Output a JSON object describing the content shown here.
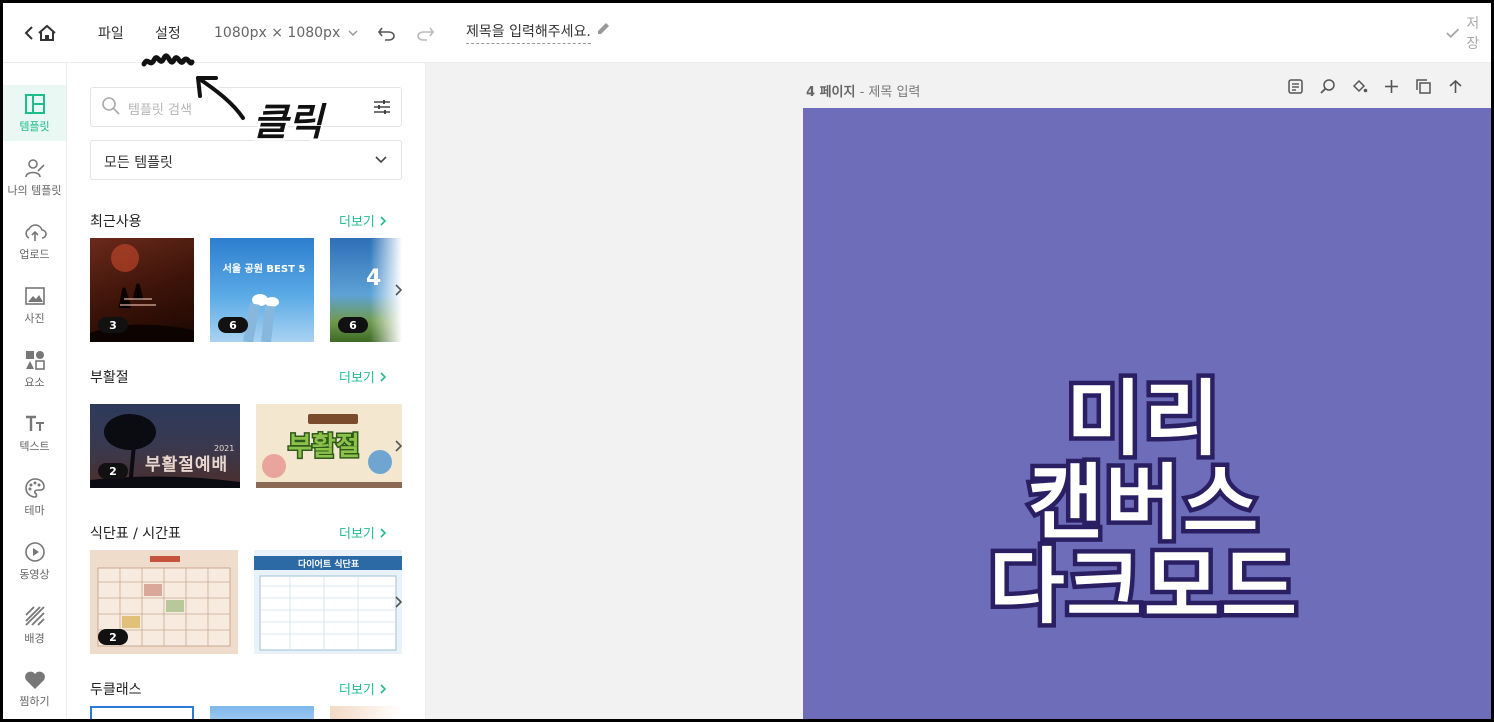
{
  "topbar": {
    "menu_file": "파일",
    "menu_settings": "설정",
    "canvas_size": "1080px × 1080px",
    "doc_title": "제목을 입력해주세요.",
    "save_label": "저장"
  },
  "annotation": {
    "click_text": "클릭"
  },
  "rail": {
    "items": [
      {
        "label": "템플릿",
        "icon": "template-icon",
        "active": true
      },
      {
        "label": "나의 템플릿",
        "icon": "my-template-icon"
      },
      {
        "label": "업로드",
        "icon": "upload-icon"
      },
      {
        "label": "사진",
        "icon": "photo-icon"
      },
      {
        "label": "요소",
        "icon": "elements-icon"
      },
      {
        "label": "텍스트",
        "icon": "text-icon"
      },
      {
        "label": "테마",
        "icon": "palette-icon"
      },
      {
        "label": "동영상",
        "icon": "video-icon"
      },
      {
        "label": "배경",
        "icon": "background-icon"
      },
      {
        "label": "찜하기",
        "icon": "heart-icon"
      }
    ]
  },
  "panel": {
    "search_placeholder": "템플릿 검색",
    "dropdown_value": "모든 템플릿",
    "more_label": "더보기",
    "sections": [
      {
        "title": "최근사용",
        "badges": [
          "3",
          "6",
          "6"
        ]
      },
      {
        "title": "부활절",
        "badges": [
          "2"
        ]
      },
      {
        "title": "식단표 / 시간표",
        "badges": [
          "2"
        ]
      },
      {
        "title": "두클래스",
        "badges": []
      }
    ],
    "thumb_text": {
      "easter_main": "부활절예배",
      "easter_year": "2021",
      "easter_2": "부활절",
      "seoul": "서울 공원 BEST 5",
      "diet": "다이어트 식단표",
      "four": "4"
    }
  },
  "workspace": {
    "page_number": "4 페이지",
    "page_title_hint": " - 제목 입력",
    "canvas_lines": [
      "미리",
      "캔버스",
      "다크모드"
    ],
    "canvas_bg": "#6e6db9",
    "accent": "#1dbd8c"
  }
}
